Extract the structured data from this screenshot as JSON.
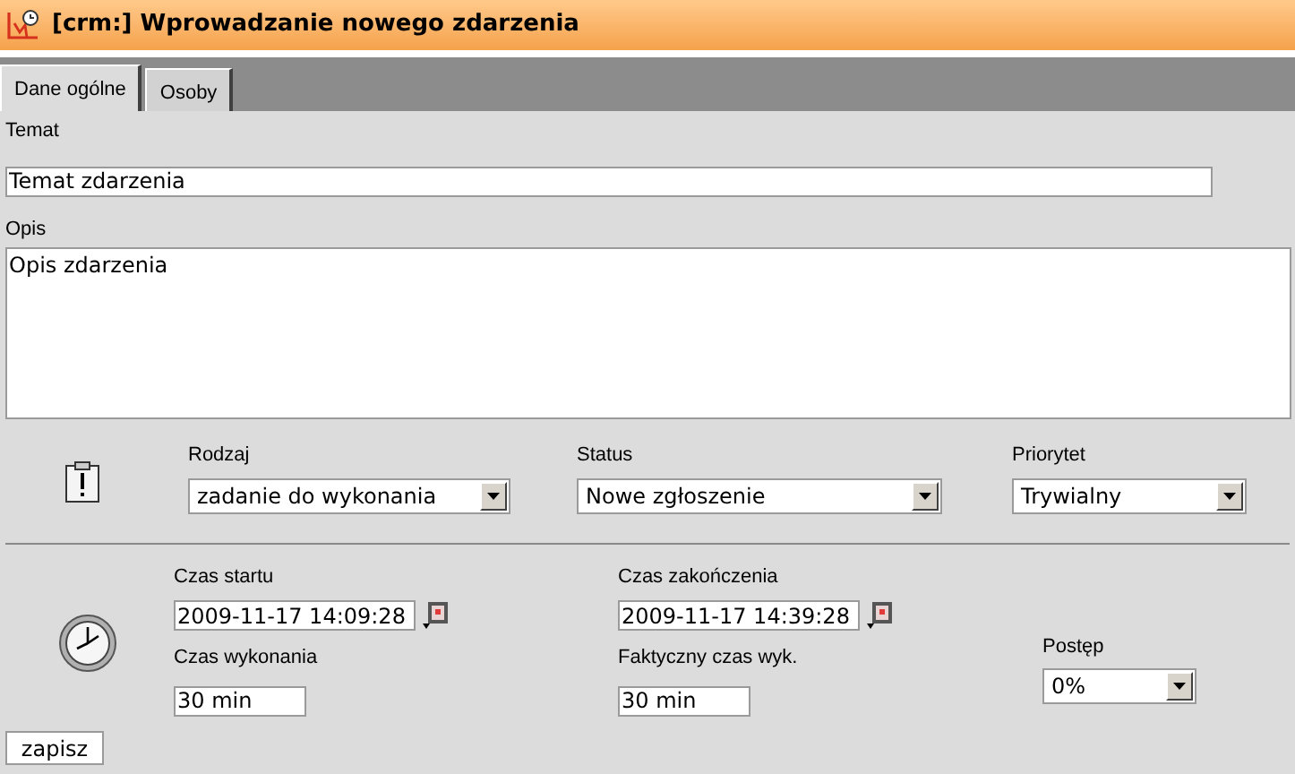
{
  "window": {
    "title": "[crm:] Wprowadzanie nowego zdarzenia"
  },
  "tabs": [
    {
      "label": "Dane ogólne",
      "selected": true
    },
    {
      "label": "Osoby",
      "selected": false
    }
  ],
  "subject": {
    "label": "Temat",
    "value": "Temat zdarzenia"
  },
  "description": {
    "label": "Opis",
    "value": "Opis zdarzenia"
  },
  "type": {
    "label": "Rodzaj",
    "value": "zadanie do wykonania"
  },
  "status": {
    "label": "Status",
    "value": "Nowe zgłoszenie"
  },
  "priority": {
    "label": "Priorytet",
    "value": "Trywialny"
  },
  "start_time": {
    "label": "Czas startu",
    "value": "2009-11-17 14:09:28"
  },
  "end_time": {
    "label": "Czas zakończenia",
    "value": "2009-11-17 14:39:28"
  },
  "duration": {
    "label": "Czas wykonania",
    "value": "30 min"
  },
  "actual_duration": {
    "label": "Faktyczny czas wyk.",
    "value": "30 min"
  },
  "progress": {
    "label": "Postęp",
    "value": "0%"
  },
  "save_button": "zapisz"
}
